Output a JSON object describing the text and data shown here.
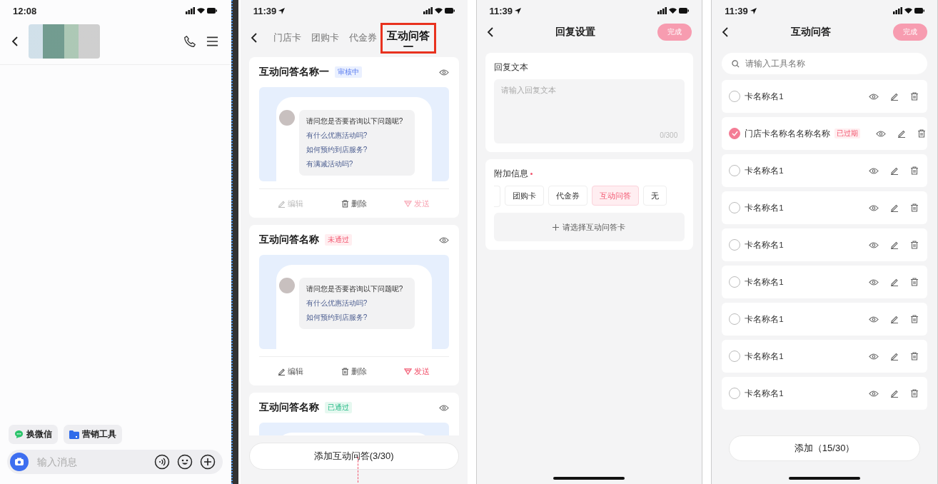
{
  "chat_screen": {
    "status_bar": {
      "time": "12:08"
    },
    "quick_actions": [
      {
        "label": "换微信",
        "kind": "chat"
      },
      {
        "label": "营销工具",
        "kind": "folder"
      }
    ],
    "message_input": {
      "placeholder": "输入消息"
    }
  },
  "qa_list_screen": {
    "status_bar": {
      "time": "11:39"
    },
    "tabs": [
      {
        "label": "门店卡",
        "selected": false
      },
      {
        "label": "团购卡",
        "selected": false
      },
      {
        "label": "代金券",
        "selected": false
      },
      {
        "label": "互动问答",
        "selected": true
      }
    ],
    "cards": [
      {
        "title": "互动问答名称一",
        "status": {
          "label": "审核中",
          "kind": "review"
        },
        "preview": {
          "question": "请问您是否要咨询以下问题呢?",
          "options": [
            "有什么优惠活动吗?",
            "如何预约到店服务?",
            "有满减活动吗?"
          ]
        },
        "actions": [
          {
            "label": "编辑",
            "kind": "edit",
            "disabled": true
          },
          {
            "label": "删除",
            "kind": "delete",
            "disabled": false
          },
          {
            "label": "发送",
            "kind": "send",
            "disabled": true
          }
        ]
      },
      {
        "title": "互动问答名称",
        "status": {
          "label": "未通过",
          "kind": "rejected"
        },
        "preview": {
          "question": "请问您是否要咨询以下问题呢?",
          "options": [
            "有什么优惠活动吗?",
            "如何预约到店服务?"
          ]
        },
        "actions": [
          {
            "label": "编辑",
            "kind": "edit",
            "disabled": false
          },
          {
            "label": "删除",
            "kind": "delete",
            "disabled": false
          },
          {
            "label": "发送",
            "kind": "send",
            "disabled": false
          }
        ]
      },
      {
        "title": "互动问答名称",
        "status": {
          "label": "已通过",
          "kind": "approved"
        }
      }
    ],
    "add_button": "添加互动问答(3/30)"
  },
  "reply_settings_screen": {
    "status_bar": {
      "time": "11:39"
    },
    "title": "回复设置",
    "done_button": {
      "label": "完成",
      "disabled": true
    },
    "reply_text": {
      "label": "回复文本",
      "placeholder": "请输入回复文本",
      "counter": "0/300"
    },
    "extra_info": {
      "label": "附加信息",
      "required": true,
      "options": [
        {
          "label": "团购卡",
          "selected": false
        },
        {
          "label": "代金券",
          "selected": false
        },
        {
          "label": "互动问答",
          "selected": true
        },
        {
          "label": "无",
          "selected": false
        }
      ],
      "select_button": "请选择互动问答卡"
    }
  },
  "qa_picker_screen": {
    "status_bar": {
      "time": "11:39"
    },
    "title": "互动问答",
    "done_button": {
      "label": "完成",
      "disabled": true
    },
    "search": {
      "placeholder": "请输入工具名称"
    },
    "items": [
      {
        "name": "卡名称名1",
        "selected": false
      },
      {
        "name": "门店卡名称名名称名称",
        "selected": true,
        "badge": "已过期"
      },
      {
        "name": "卡名称名1",
        "selected": false
      },
      {
        "name": "卡名称名1",
        "selected": false
      },
      {
        "name": "卡名称名1",
        "selected": false
      },
      {
        "name": "卡名称名1",
        "selected": false
      },
      {
        "name": "卡名称名1",
        "selected": false
      },
      {
        "name": "卡名称名1",
        "selected": false
      },
      {
        "name": "卡名称名1",
        "selected": false
      }
    ],
    "add_button": "添加（15/30）"
  }
}
